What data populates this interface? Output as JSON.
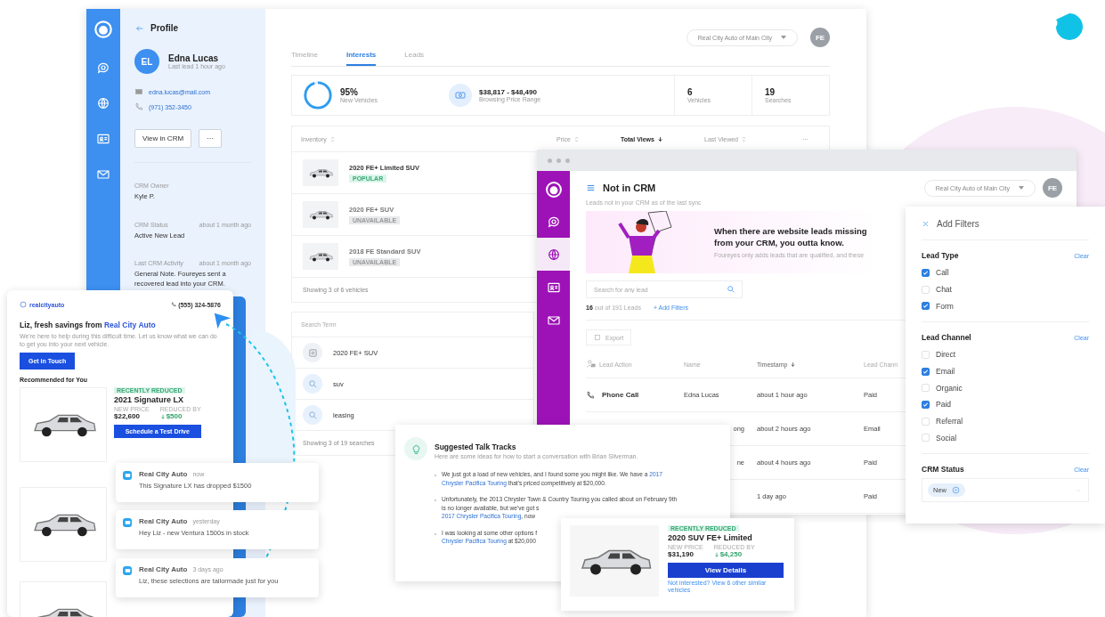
{
  "profile_window": {
    "profile": {
      "back_label": "Profile",
      "initials": "EL",
      "name": "Edna Lucas",
      "last_lead": "Last lead 1 hour ago",
      "email": "edna.lucas@mail.com",
      "phone": "(971) 352-3450",
      "primary_button": "View in CRM",
      "more_button": "···",
      "fields": [
        {
          "label": "CRM Owner",
          "value": "Kyle P."
        },
        {
          "label": "CRM Status",
          "time": "about 1 month ago",
          "value": "Active New Lead"
        },
        {
          "label": "Last CRM Activity",
          "time": "about 1 month ago",
          "value": "General Note. Foureyes sent a recovered lead into your CRM."
        }
      ]
    },
    "dealer_select": "Real City Auto of Main City",
    "user_initials": "FE",
    "tabs": [
      {
        "label": "Timeline",
        "selected": false
      },
      {
        "label": "Interests",
        "selected": true
      },
      {
        "label": "Leads",
        "selected": false
      }
    ],
    "stats": [
      {
        "kind": "ring",
        "value": "95%",
        "label": "New Vehicles",
        "level": 0.95
      },
      {
        "kind": "price",
        "value": "$38,817 - $48,490",
        "label": "Browsing Price Range"
      },
      {
        "kind": "count",
        "value": "6",
        "label": "Vehicles"
      },
      {
        "kind": "count",
        "value": "19",
        "label": "Searches"
      }
    ],
    "inventory": {
      "columns": [
        {
          "label": "Inventory",
          "sorted": false
        },
        {
          "label": "Price",
          "sorted": false
        },
        {
          "label": "Total Views",
          "sorted": true
        },
        {
          "label": "Last Viewed",
          "sorted": false
        }
      ],
      "more": "···",
      "rows": [
        {
          "name": "2020 FE+ Limited SUV",
          "badge": "POPULAR",
          "available": true
        },
        {
          "name": "2020 FE+ SUV",
          "badge": "UNAVAILABLE",
          "available": false
        },
        {
          "name": "2018 FE Standard SUV",
          "badge": "UNAVAILABLE",
          "available": false
        }
      ],
      "footer": "Showing 3 of 6 vehicles"
    },
    "searches": {
      "heading": "Search Term",
      "rows": [
        {
          "kind": "vehicle",
          "term": "2020 FE+ SUV"
        },
        {
          "kind": "search",
          "term": "suv"
        },
        {
          "kind": "search",
          "term": "leasing"
        }
      ],
      "footer": "Showing 3 of 19 searches"
    }
  },
  "crm_window": {
    "title": "Not in CRM",
    "subtitle": "Leads not in your CRM as of the last sync",
    "dealer_select": "Real City Auto of Main City",
    "user_initials": "FE",
    "nav": [
      {
        "kind": "chat",
        "selected": false
      },
      {
        "kind": "globe",
        "selected": true
      },
      {
        "kind": "contact",
        "selected": false
      },
      {
        "kind": "mail",
        "selected": false
      }
    ],
    "banner": {
      "heading": "When there are website leads missing from your CRM, you outta know.",
      "text": "Foureyes only adds leads that are qualified, and these"
    },
    "search_placeholder": "Search for any lead",
    "count": "16",
    "count_text": "out of 191 Leads",
    "add_filters": "+ Add Filters",
    "export": "Export",
    "columns": [
      {
        "label": "Lead Action",
        "sorted": false
      },
      {
        "label": "Name",
        "sorted": false
      },
      {
        "label": "Timestamp",
        "sorted": true
      },
      {
        "label": "Lead Chann",
        "sorted": false
      }
    ],
    "rows": [
      {
        "action": "Phone Call",
        "name": "Edna Lucas",
        "time": "about 1 hour ago",
        "channel": "Paid"
      },
      {
        "name": "ong",
        "time": "about 2 hours ago",
        "channel": "Email"
      },
      {
        "name": "ne",
        "time": "about 4 hours ago",
        "channel": "Paid"
      },
      {
        "time": "1 day ago",
        "channel": "Paid"
      }
    ]
  },
  "filters": {
    "title": "Add Filters",
    "groups": [
      {
        "kind": "checkboxes",
        "title": "Lead Type",
        "clear": "Clear",
        "options": [
          {
            "label": "Call",
            "checked": true
          },
          {
            "label": "Chat",
            "checked": false
          },
          {
            "label": "Form",
            "checked": true
          }
        ]
      },
      {
        "kind": "checkboxes",
        "title": "Lead Channel",
        "clear": "Clear",
        "options": [
          {
            "label": "Direct",
            "checked": false
          },
          {
            "label": "Email",
            "checked": true
          },
          {
            "label": "Organic",
            "checked": false
          },
          {
            "label": "Paid",
            "checked": true
          },
          {
            "label": "Referral",
            "checked": false
          },
          {
            "label": "Social",
            "checked": false
          }
        ]
      },
      {
        "kind": "tags",
        "title": "CRM Status",
        "clear": "Clear",
        "tags": [
          "New"
        ]
      }
    ]
  },
  "email_card": {
    "logo": "realcityauto",
    "phone": "(555) 324-5876",
    "headline": "Liz, fresh savings from",
    "headline_link": "Real City Auto",
    "intro": "We're here to help during this difficult time. Let us know what we can do to get you into your next vehicle.",
    "cta": "Get in Touch",
    "section": "Recommended for You",
    "offer": {
      "badge": "RECENTLY REDUCED",
      "title": "2021 Signature LX",
      "price_label": "NEW PRICE",
      "price": "$22,600",
      "reduced_label": "REDUCED BY",
      "reduced": "$500",
      "button": "Schedule a Test Drive"
    }
  },
  "notifications": [
    {
      "sender": "Real City Auto",
      "time": "now",
      "message": "This Signature LX has dropped $1500"
    },
    {
      "sender": "Real City Auto",
      "time": "yesterday",
      "message": "Hey Liz - new Ventura 1500s in stock"
    },
    {
      "sender": "Real City Auto",
      "time": "3 days ago",
      "message": "Liz, these selections are tailormade just for you"
    }
  ],
  "talk_tracks": {
    "title": "Suggested Talk Tracks",
    "subtitle": "Here are some ideas for how to start a conversation with Brian Silverman.",
    "items": [
      [
        [
          {
            "text": "We just got a load of new vehicles, and I found some you might like. We have a "
          },
          {
            "text": "2017",
            "link": true
          }
        ],
        [
          {
            "text": "Chrysler Pacifica Touring",
            "link": true
          },
          {
            "text": " that's priced competitively at $20,000."
          }
        ]
      ],
      [
        [
          {
            "text": "Unfortunately, the 2013 Chrysler Town & Country Touring you called about on February 9th"
          }
        ],
        [
          {
            "text": "is no longer available, but we've got s"
          }
        ],
        [
          {
            "text": "2017 Chrysler Pacifica Touring",
            "link": true
          },
          {
            "text": ", now"
          }
        ]
      ],
      [
        [
          {
            "text": "I was looking at some other options f"
          }
        ],
        [
          {
            "text": "Chrysler Pacifica Touring",
            "link": true
          },
          {
            "text": " at $20,000"
          }
        ]
      ]
    ]
  },
  "product_card": {
    "badge": "RECENTLY REDUCED",
    "title": "2020 SUV FE+ Limited",
    "price_label": "NEW PRICE",
    "price": "$31,190",
    "reduced_label": "REDUCED BY",
    "reduced": "$4,250",
    "button": "View Details",
    "link": "Not interested? View 6 other similar vehicles"
  }
}
